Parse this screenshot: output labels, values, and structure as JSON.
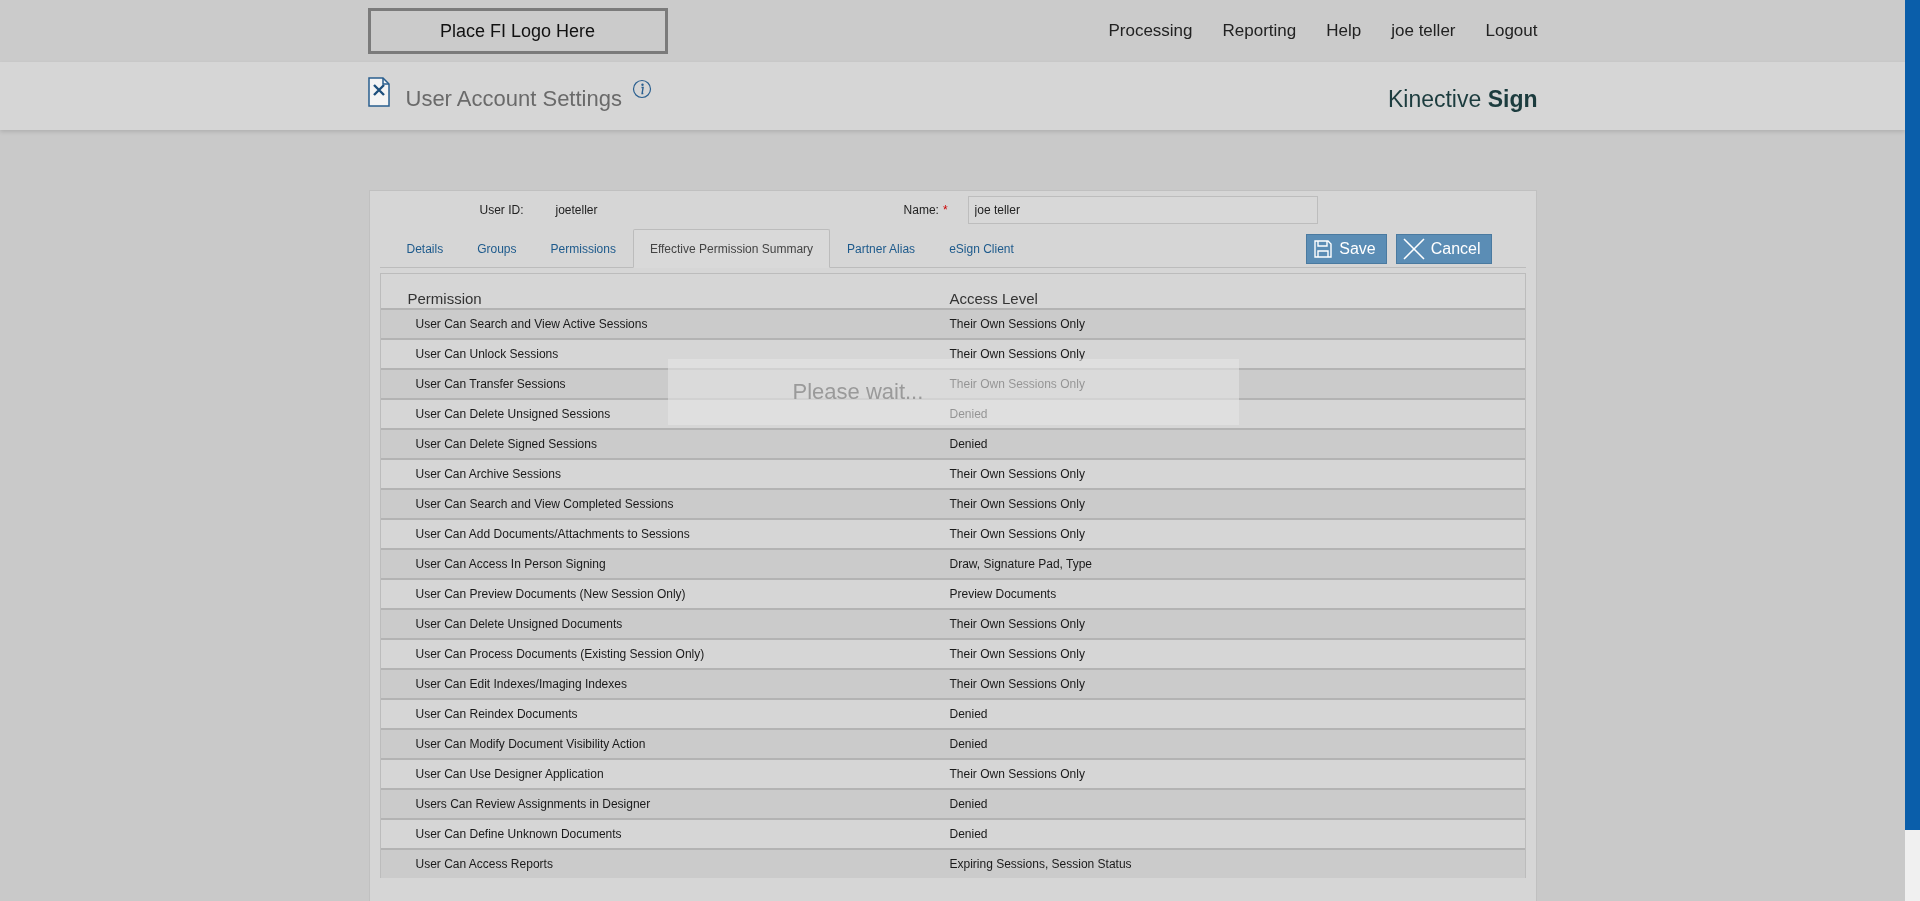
{
  "header": {
    "logo_placeholder": "Place FI Logo Here",
    "nav": [
      "Processing",
      "Reporting",
      "Help",
      "joe teller",
      "Logout"
    ]
  },
  "page": {
    "title": "User Account Settings",
    "brand": {
      "name": "Kinective",
      "product": "Sign"
    }
  },
  "user": {
    "user_id_label": "User ID:",
    "user_id": "joeteller",
    "name_label": "Name:",
    "required_mark": "*",
    "name_value": "joe teller"
  },
  "tabs": [
    {
      "label": "Details",
      "selected": false
    },
    {
      "label": "Groups",
      "selected": false
    },
    {
      "label": "Permissions",
      "selected": false
    },
    {
      "label": "Effective Permission Summary",
      "selected": true
    },
    {
      "label": "Partner Alias",
      "selected": false
    },
    {
      "label": "eSign Client",
      "selected": false
    }
  ],
  "buttons": [
    {
      "kind": "save",
      "label": "Save"
    },
    {
      "kind": "cancel",
      "label": "Cancel"
    }
  ],
  "table": {
    "columns": [
      "Permission",
      "Access Level"
    ],
    "rows": [
      [
        "User Can Search and View Active Sessions",
        "Their Own Sessions Only"
      ],
      [
        "User Can Unlock Sessions",
        "Their Own Sessions Only"
      ],
      [
        "User Can Transfer Sessions",
        "Their Own Sessions Only"
      ],
      [
        "User Can Delete Unsigned Sessions",
        "Denied"
      ],
      [
        "User Can Delete Signed Sessions",
        "Denied"
      ],
      [
        "User Can Archive Sessions",
        "Their Own Sessions Only"
      ],
      [
        "User Can Search and View Completed Sessions",
        "Their Own Sessions Only"
      ],
      [
        "User Can Add Documents/Attachments to Sessions",
        "Their Own Sessions Only"
      ],
      [
        "User Can Access In Person Signing",
        "Draw, Signature Pad, Type"
      ],
      [
        "User Can Preview Documents (New Session Only)",
        "Preview Documents"
      ],
      [
        "User Can Delete Unsigned Documents",
        "Their Own Sessions Only"
      ],
      [
        "User Can Process Documents (Existing Session Only)",
        "Their Own Sessions Only"
      ],
      [
        "User Can Edit Indexes/Imaging Indexes",
        "Their Own Sessions Only"
      ],
      [
        "User Can Reindex Documents",
        "Denied"
      ],
      [
        "User Can Modify Document Visibility Action",
        "Denied"
      ],
      [
        "User Can Use Designer Application",
        "Their Own Sessions Only"
      ],
      [
        "Users Can Review Assignments in Designer",
        "Denied"
      ],
      [
        "User Can Define Unknown Documents",
        "Denied"
      ],
      [
        "User Can Access Reports",
        "Expiring Sessions, Session Status"
      ]
    ]
  },
  "loading": {
    "message": "Please wait..."
  }
}
